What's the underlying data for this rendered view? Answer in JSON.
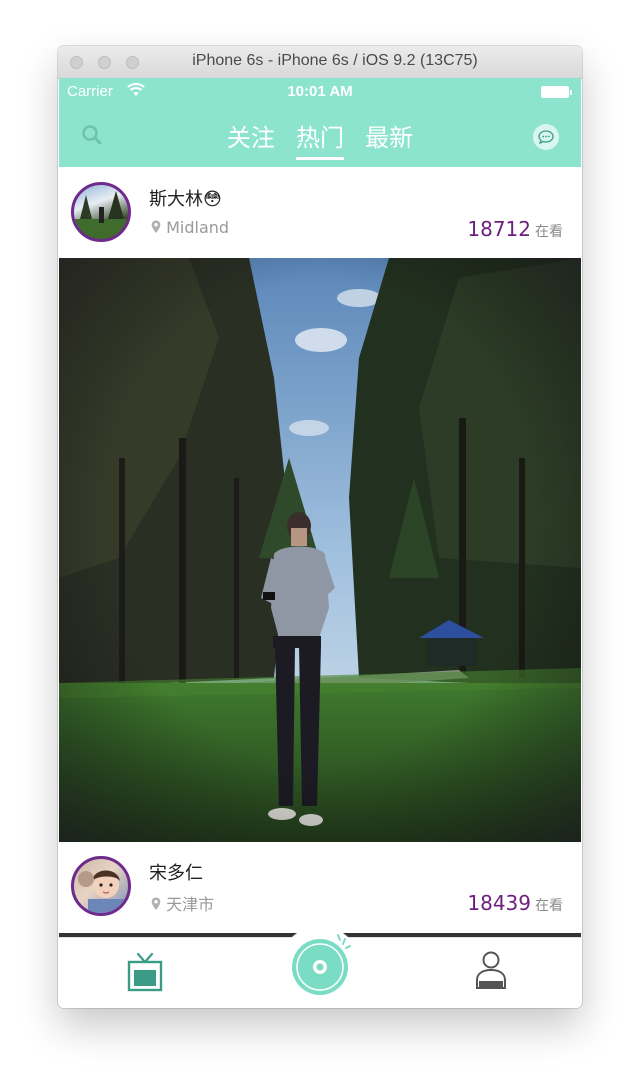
{
  "window": {
    "title": "iPhone 6s - iPhone 6s / iOS 9.2 (13C75)"
  },
  "status_bar": {
    "carrier": "Carrier",
    "time": "10:01 AM"
  },
  "nav": {
    "tabs": [
      {
        "label": "关注",
        "active": false
      },
      {
        "label": "热门",
        "active": true
      },
      {
        "label": "最新",
        "active": false
      }
    ],
    "left_icon": "search-icon",
    "right_icon": "chat-bubble-icon"
  },
  "feed": [
    {
      "username": "斯大林😳",
      "location": "Midland",
      "viewers": "18712",
      "viewers_suffix": "在看"
    },
    {
      "username": "宋多仁",
      "location": "天津市",
      "viewers": "18439",
      "viewers_suffix": "在看"
    }
  ],
  "tab_bar": {
    "items": [
      {
        "icon": "tv-icon"
      },
      {
        "icon": "camera-record-icon"
      },
      {
        "icon": "profile-icon"
      }
    ]
  },
  "colors": {
    "accent": "#8ce4ce",
    "viewer_count": "#6d1f7e",
    "avatar_ring": "#6e2a8c",
    "icon_teal": "#3a9c86"
  }
}
